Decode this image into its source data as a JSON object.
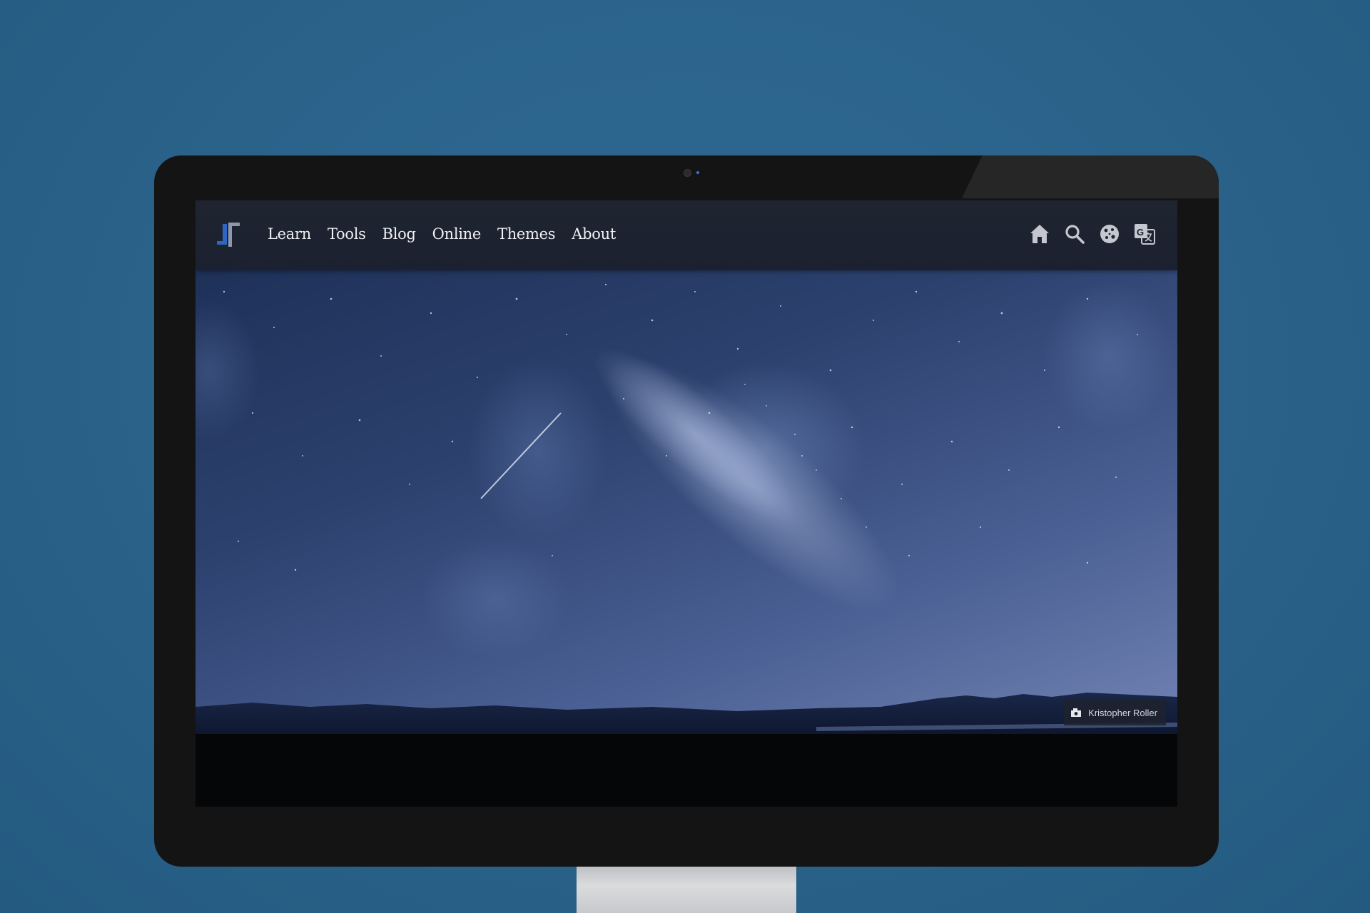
{
  "nav": {
    "links": [
      "Learn",
      "Tools",
      "Blog",
      "Online",
      "Themes",
      "About"
    ],
    "icons": [
      "home-icon",
      "search-icon",
      "cookie-icon",
      "translate-icon"
    ]
  },
  "hero": {
    "photo_credit": "Kristopher Roller"
  },
  "colors": {
    "background": "#2a628a",
    "navbar": "#1d2230",
    "logo_accent": "#2f66c4"
  }
}
